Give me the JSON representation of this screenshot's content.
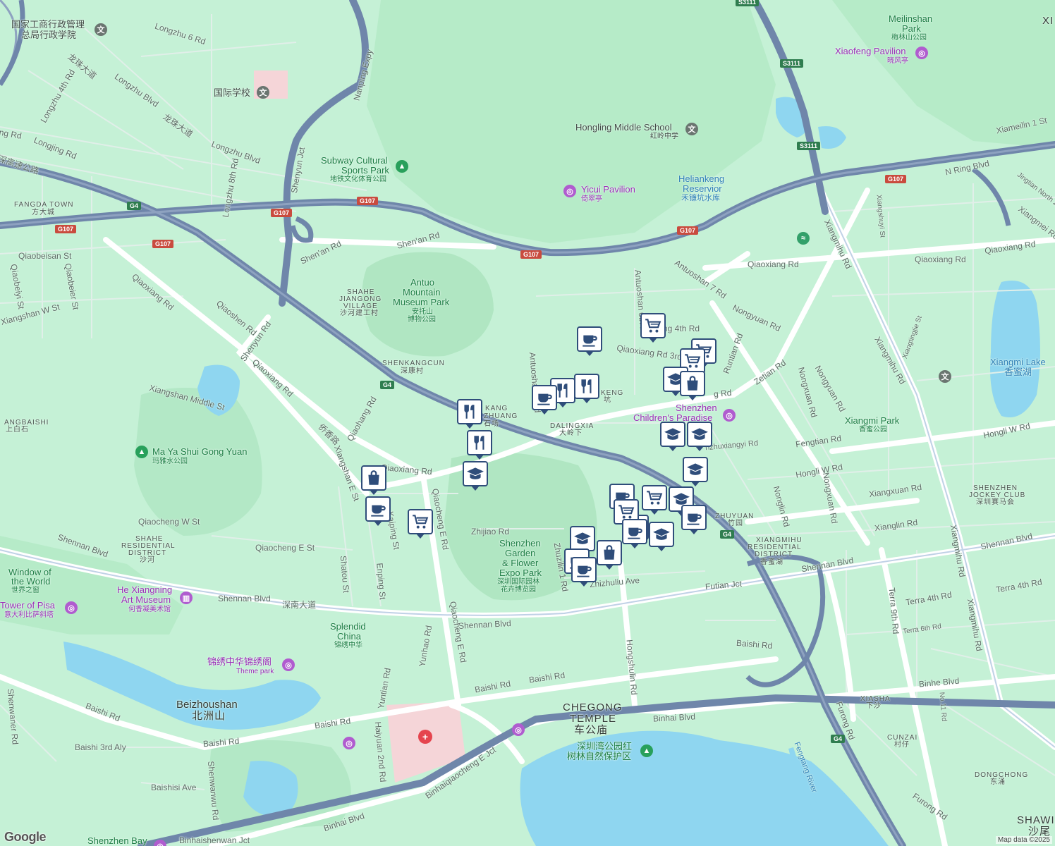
{
  "map": {
    "colors": {
      "land": "#c5f1d6",
      "forest": "#b3e8c6",
      "water": "#8fd6f0",
      "road": "#e6f1ee",
      "highway": "#6f86aa",
      "arterial": "#a9bdd6",
      "pin_border": "#2f4d7a",
      "campus": "#f5d5d8"
    },
    "shields": [
      {
        "id": "g107",
        "text": "G107"
      },
      {
        "id": "g4",
        "text": "G4"
      },
      {
        "id": "s3111",
        "text": "S3111"
      }
    ],
    "labels": {
      "roads": {
        "longzhu6": "Longzhu 6 Rd",
        "longzhuBlvdZh": "龙珠大道",
        "longzhuBlvd": "Longzhu Blvd",
        "longzhu4": "Longzhu 4th Rd",
        "longzhuBlvdZh2": "龙珠大道",
        "longzhuBlvd2": "Longzhu Blvd",
        "longjing": "Longjing Rd",
        "longzhu8": "Longzhu 8th Rd",
        "nanpingExpy": "Nanping Expy",
        "shenyunJct": "Shenyun Jct",
        "shenan1": "Shen'an Rd",
        "shenan2": "Shen'an Rd",
        "qiaobeisan": "Qiaobeisan St",
        "qiaobeiyi": "Qiaobeiyi St",
        "qiaobeier": "Qiaobeier St",
        "xiangshanW": "Xiangshan W St",
        "qiaoxiang1": "Qiaoxiang Rd",
        "qiaoshen": "Qiaoshen Rd",
        "shenyun": "Shenyun Rd",
        "qiaoxiang2": "Qiaoxiang Rd",
        "xiangshanMid": "Xiangshan Middle St",
        "qiaohang": "Qiaohang Rd",
        "qiaoxiangZh": "侨香路",
        "xiangshanE": "Xiangshan E St",
        "qiaoxiang3": "Qiaoxiang Rd",
        "qiaochengW": "Qiaocheng W St",
        "qiaochengE": "Qiaocheng E St",
        "shennan1": "Shennan Blvd",
        "shennan2": "Shennan Blvd",
        "shennanZh": "深南大道",
        "shennan3": "Shennan Blvd",
        "shennan4": "Shennan Blvd",
        "shennan5": "Shennan Blvd",
        "shatou": "Shatou St",
        "enping": "Enping St",
        "kaiping": "Kaiping St",
        "qiaochengERd1": "Qiaocheng E Rd",
        "qiaochengERd2": "Qiaocheng E Rd",
        "zhijiao": "Zhijiao Rd",
        "zhuzilin1": "Zhuzilin 1 Rd",
        "zhizhuliu": "Zhizhuliu Ave",
        "futianJct": "Futian Jct",
        "hongshulin": "Hongshulin Rd",
        "baishi1": "Baishi Rd",
        "baishi2": "Baishi Rd",
        "baishi3": "Baishi Rd",
        "baishi4": "Baishi Rd",
        "baishi5": "Baishi Rd",
        "baishi6": "Baishi Rd",
        "baishi3rd": "Baishi 3rd Aly",
        "baishisi": "Baishisi Ave",
        "shenwaner": "Shenwaner Rd",
        "shenwanwu": "Shenwanwu Rd",
        "yuntian": "Yuntian Rd",
        "yunhao": "Yunhao Rd",
        "haiyuan2": "Haiyuan 2nd Rd",
        "binhaiqiaocheng": "Binhaiqiaocheng E Jct",
        "binhai1": "Binhai Blvd",
        "binhai2": "Binhai Blvd",
        "binhaishenwan": "Binhaishenwan Jct",
        "binhe": "Binhe Blvd",
        "furong1": "Furong Rd",
        "furong2": "Furong Rd",
        "antuoshan6": "Antuoshan 6th Rd",
        "antuoshan1": "Antuoshan 1 Rd",
        "antuoshan7": "Antuoshan 7 Rd",
        "antuo4": "ng 4th Rd",
        "qiaoxiang3rd": "Qiaoxiang Rd 3rd",
        "qiaoxiang4": "Qiaoxiang Rd",
        "qiaoxiang5": "Qiaoxiang Rd",
        "qiaoxiang6": "Qiaoxiang Rd",
        "nongyuan1": "Nongyuan Rd",
        "nongyuan2": "Nongyuan Rd",
        "runtian": "Runtian Rd",
        "zetian": "Zetian Rd",
        "nongxuan1": "Nongxuan Rd",
        "nongxuan2": "Nongxuan Rd",
        "fengtian": "Fengtian Rd",
        "hongliW1": "Hongli W Rd",
        "hongliW2": "Hongli W Rd",
        "nonglin": "Nonglin Rd",
        "xiangxuan": "Xiangxuan Rd",
        "xianglin": "Xianglin Rd",
        "xiangmihu1": "Xiangmihu Rd",
        "xiangmihu2": "Xiangmihu Rd",
        "xiangmihu3": "Xiangmihu Rd",
        "xiangmihu4": "Xiangmihu Rd",
        "terra4a": "Terra 4th Rd",
        "terra4b": "Terra 4th Rd",
        "terra6": "Terra 6th Rd",
        "terra9": "Terra 9th Rd",
        "no11": "No.11 Rd",
        "nRing": "N Ring Blvd",
        "xiameilin": "Xiameilin 1 St",
        "jingtian": "Jingtian North 2",
        "xiangmei": "Xiangmei Rd",
        "xiangshu": "Xiangshuyi St",
        "xiangting": "Xiangtingjie St",
        "ngzhuxiangyi": "nzhuxiangyi Rd",
        "gRd": "g Rd",
        "shenzhenHwyZh": "深高速公路",
        "ingRd": "ing Rd"
      },
      "places": {
        "govSchool": "国家工商行政管理",
        "govSchool2": "总局行政学院",
        "intlSchool": "国际学校",
        "fangda": "FANGDA TOWN",
        "fangdaZh": "方大城",
        "subwayPark": "Subway Cultural",
        "subwayPark2": "Sports Park",
        "subwayParkZh": "地铁文化体育公园",
        "hongling": "Hongling Middle School",
        "honglingZh": "红岭中学",
        "yicui": "Yicui Pavilion",
        "yicuiZh": "倚翠亭",
        "heliankeng": "Heliankeng",
        "heliankeng2": "Reservior",
        "heliankengZh": "禾镰坑水库",
        "meilinshan": "Meilinshan",
        "meilinshan2": "Park",
        "meilinshanZh": "梅林山公园",
        "xiaofeng": "Xiaofeng Pavilion",
        "xiaofengZh": "晓风亭",
        "antuoMuseum": "Antuo",
        "antuoMuseum2": "Mountain",
        "antuoMuseum3": "Museum Park",
        "antuoMuseumZh": "安托山",
        "antuoMuseumZh2": "博物公园",
        "shaheJ": "SHAHE",
        "shaheJ2": "JIANGONG",
        "shaheJ3": "VILLAGE",
        "shaheJZh": "沙河建工村",
        "shenkangcun": "SHENKANGCUN",
        "shenkangcunZh": "深康村",
        "xiangmiLake": "Xiangmi Lake",
        "xiangmiLakeZh": "香蜜湖",
        "xiangmiPark": "Xiangmi Park",
        "xiangmiParkZh": "香蜜公园",
        "childrenPark": "Shenzhen",
        "childrenPark2": "Children's Paradise",
        "dalingxia": "DALINGXIA",
        "dalingxiaZh": "大岭下",
        "keng": "KENG",
        "kengZh": "坑",
        "kangZhuang": "KANG",
        "kangZhuang2": "ZHUANG",
        "kangZh": "石场",
        "shangbaishi": "ANGBAISHI",
        "shangbaishiZh": "上白石",
        "mayashui": "Ma Ya Shui Gong Yuan",
        "mayashuiZh": "玛雅水公园",
        "shaheRes": "SHAHE",
        "shaheRes2": "RESIDENTIAL",
        "shaheRes3": "DISTRICT",
        "shaheResZh": "沙河",
        "windowWorld": "Window of",
        "windowWorld2": "the World",
        "windowWorldZh": "世界之窗",
        "heXiangning": "He Xiangning",
        "heXiangning2": "Art Museum",
        "heXiangningZh": "何香凝美术馆",
        "pisa": "Tower of Pisa",
        "pisaZh": "意大利比萨斜塔",
        "splendid": "Splendid",
        "splendid2": "China",
        "splendidZh": "锦绣中华",
        "themeParkZh": "锦绣中华锦绣阁",
        "themePark": "Theme park",
        "beizhoushan": "Beizhoushan",
        "beizhoushanZh": "北洲山",
        "gardenExpo": "Shenzhen",
        "gardenExpo2": "Garden",
        "gardenExpo3": "& Flower",
        "gardenExpo4": "Expo Park",
        "gardenExpoZh": "深圳国际园林",
        "gardenExpoZh2": "花卉博览园",
        "zhuyuan": "ZHUYUAN",
        "zhuyuanZh": "竹园",
        "xiangmihuRes": "XIANGMIHU",
        "xiangmihuRes2": "RESIDENTIAL",
        "xiangmihuRes3": "DISTRICT",
        "xiangmihuResZh": "香蜜湖",
        "jockey": "SHENZHEN",
        "jockey2": "JOCKEY CLUB",
        "jockeyZh": "深圳赛马会",
        "chegong": "CHEGONG",
        "chegong2": "TEMPLE",
        "chegongZh": "车公庙",
        "mangrove": "深圳湾公园红",
        "mangrove2": "树林自然保护区",
        "xiasha": "XIASHA",
        "xiashaZh": "下沙",
        "cunzai": "CUNZAI",
        "cunzaiZh": "村仔",
        "dongchong": "DONGCHONG",
        "dongchongZh": "东涌",
        "shawei": "SHAWI",
        "shaweiZh": "沙尾",
        "fengtangRiver": "Fengtang River",
        "shenzhenBay": "Shenzhen Bay",
        "xi": "XI",
        "n": "N"
      }
    },
    "pins": [
      {
        "type": "grocery",
        "n": 1
      },
      {
        "type": "cafe",
        "n": 2
      },
      {
        "type": "grocery",
        "n": 3
      },
      {
        "type": "grocery",
        "n": 4
      },
      {
        "type": "school",
        "n": 5
      },
      {
        "type": "shopping",
        "n": 6
      },
      {
        "type": "restaurant",
        "n": 7
      },
      {
        "type": "restaurant",
        "n": 8
      },
      {
        "type": "cafe",
        "n": 9
      },
      {
        "type": "restaurant",
        "n": 10
      },
      {
        "type": "restaurant",
        "n": 11
      },
      {
        "type": "school",
        "n": 12
      },
      {
        "type": "school",
        "n": 13
      },
      {
        "type": "school",
        "n": 14
      },
      {
        "type": "school",
        "n": 15
      },
      {
        "type": "cafe",
        "n": 16
      },
      {
        "type": "shopping",
        "n": 17
      },
      {
        "type": "cafe",
        "n": 18
      },
      {
        "type": "grocery",
        "n": 19
      },
      {
        "type": "cafe",
        "n": 20
      },
      {
        "type": "grocery",
        "n": 21
      },
      {
        "type": "school",
        "n": 22
      },
      {
        "type": "grocery",
        "n": 23
      },
      {
        "type": "cafe",
        "n": 24
      },
      {
        "type": "school",
        "n": 25
      },
      {
        "type": "school",
        "n": 26
      },
      {
        "type": "cafe",
        "n": 27
      },
      {
        "type": "shopping",
        "n": 28
      },
      {
        "type": "cafe",
        "n": 29
      },
      {
        "type": "cafe",
        "n": 30
      }
    ],
    "attribution": "Map data ©2025",
    "logo": "Google"
  }
}
